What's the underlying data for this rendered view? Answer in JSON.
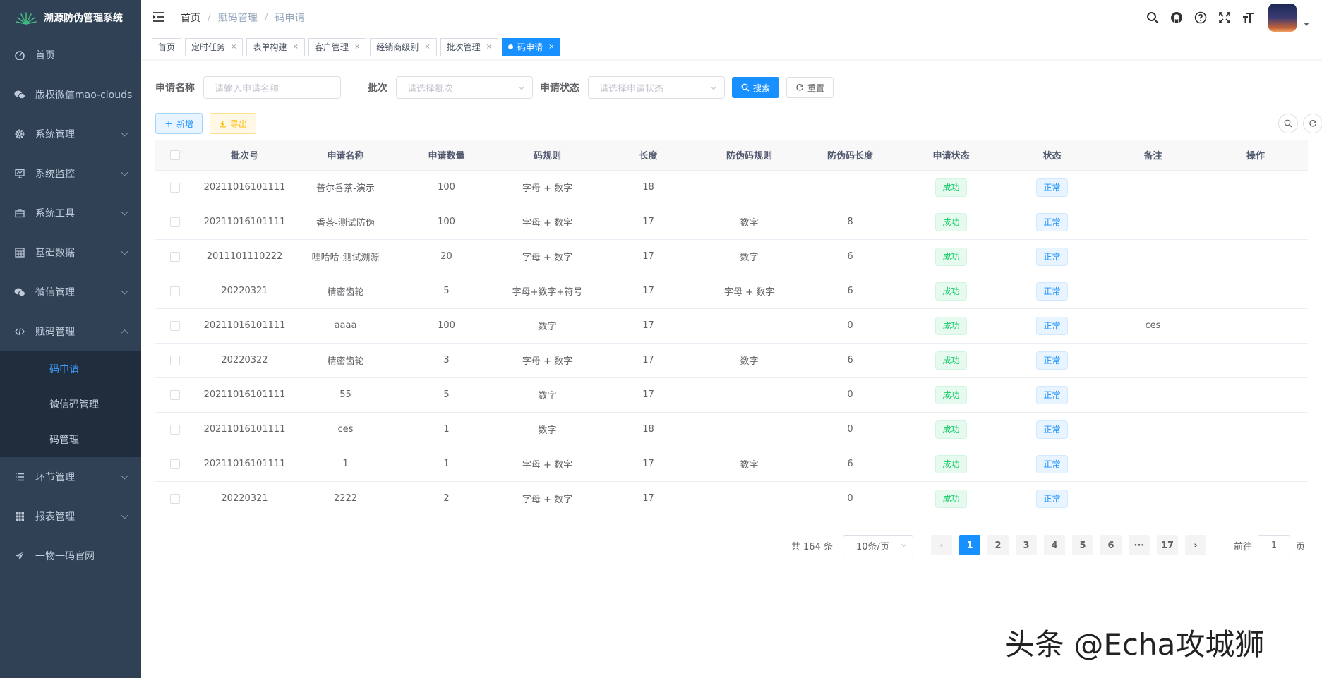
{
  "sidebar": {
    "title": "溯源防伪管理系统",
    "items": [
      {
        "label": "首页"
      },
      {
        "label": "版权微信mao-clouds"
      },
      {
        "label": "系统管理"
      },
      {
        "label": "系统监控"
      },
      {
        "label": "系统工具"
      },
      {
        "label": "基础数据"
      },
      {
        "label": "微信管理"
      },
      {
        "label": "赋码管理"
      },
      {
        "label": "环节管理"
      },
      {
        "label": "报表管理"
      },
      {
        "label": "一物一码官网"
      }
    ],
    "submenu": [
      {
        "label": "码申请"
      },
      {
        "label": "微信码管理"
      },
      {
        "label": "码管理"
      }
    ]
  },
  "navbar": {
    "breadcrumb": [
      "首页",
      "赋码管理",
      "码申请"
    ],
    "separator": "/"
  },
  "tags": [
    {
      "label": "首页"
    },
    {
      "label": "定时任务"
    },
    {
      "label": "表单构建"
    },
    {
      "label": "客户管理"
    },
    {
      "label": "经销商级别"
    },
    {
      "label": "批次管理"
    },
    {
      "label": "码申请"
    }
  ],
  "search": {
    "name_label": "申请名称",
    "name_placeholder": "请输入申请名称",
    "batch_label": "批次",
    "batch_placeholder": "请选择批次",
    "status_label": "申请状态",
    "status_placeholder": "请选择申请状态",
    "search_button": "搜索",
    "reset_button": "重置"
  },
  "toolbar": {
    "add_button": "新增",
    "export_button": "导出"
  },
  "table": {
    "columns": [
      "批次号",
      "申请名称",
      "申请数量",
      "码规则",
      "长度",
      "防伪码规则",
      "防伪码长度",
      "申请状态",
      "状态",
      "备注",
      "操作"
    ],
    "rows": [
      {
        "batch": "20211016101111",
        "name": "普尔香茶-演示",
        "qty": "100",
        "rule": "字母 + 数字",
        "len": "18",
        "arule": "",
        "alen": "",
        "apply": "成功",
        "status": "正常",
        "note": ""
      },
      {
        "batch": "20211016101111",
        "name": "香茶-测试防伪",
        "qty": "100",
        "rule": "字母 + 数字",
        "len": "17",
        "arule": "数字",
        "alen": "8",
        "apply": "成功",
        "status": "正常",
        "note": ""
      },
      {
        "batch": "2011101110222",
        "name": "哇哈哈-测试溯源",
        "qty": "20",
        "rule": "字母 + 数字",
        "len": "17",
        "arule": "数字",
        "alen": "6",
        "apply": "成功",
        "status": "正常",
        "note": ""
      },
      {
        "batch": "20220321",
        "name": "精密齿轮",
        "qty": "5",
        "rule": "字母+数字+符号",
        "len": "17",
        "arule": "字母 + 数字",
        "alen": "6",
        "apply": "成功",
        "status": "正常",
        "note": ""
      },
      {
        "batch": "20211016101111",
        "name": "aaaa",
        "qty": "100",
        "rule": "数字",
        "len": "17",
        "arule": "",
        "alen": "0",
        "apply": "成功",
        "status": "正常",
        "note": "ces"
      },
      {
        "batch": "20220322",
        "name": "精密齿轮",
        "qty": "3",
        "rule": "字母 + 数字",
        "len": "17",
        "arule": "数字",
        "alen": "6",
        "apply": "成功",
        "status": "正常",
        "note": ""
      },
      {
        "batch": "20211016101111",
        "name": "55",
        "qty": "5",
        "rule": "数字",
        "len": "17",
        "arule": "",
        "alen": "0",
        "apply": "成功",
        "status": "正常",
        "note": ""
      },
      {
        "batch": "20211016101111",
        "name": "ces",
        "qty": "1",
        "rule": "数字",
        "len": "18",
        "arule": "",
        "alen": "0",
        "apply": "成功",
        "status": "正常",
        "note": ""
      },
      {
        "batch": "20211016101111",
        "name": "1",
        "qty": "1",
        "rule": "字母 + 数字",
        "len": "17",
        "arule": "数字",
        "alen": "6",
        "apply": "成功",
        "status": "正常",
        "note": ""
      },
      {
        "batch": "20220321",
        "name": "2222",
        "qty": "2",
        "rule": "字母 + 数字",
        "len": "17",
        "arule": "",
        "alen": "0",
        "apply": "成功",
        "status": "正常",
        "note": ""
      }
    ]
  },
  "pagination": {
    "total": "共 164 条",
    "page_size": "10条/页",
    "pages": [
      "1",
      "2",
      "3",
      "4",
      "5",
      "6",
      "···",
      "17"
    ],
    "prev": "‹",
    "next": "›",
    "goto_label": "前往",
    "goto_value": "1",
    "goto_suffix": "页"
  },
  "watermark": "头条 @Echa攻城狮",
  "colors": {
    "sidebar_bg": "#304156",
    "submenu_bg": "#1f2d3d",
    "primary": "#1890ff",
    "success": "#13ce66",
    "warning": "#ffba00"
  }
}
